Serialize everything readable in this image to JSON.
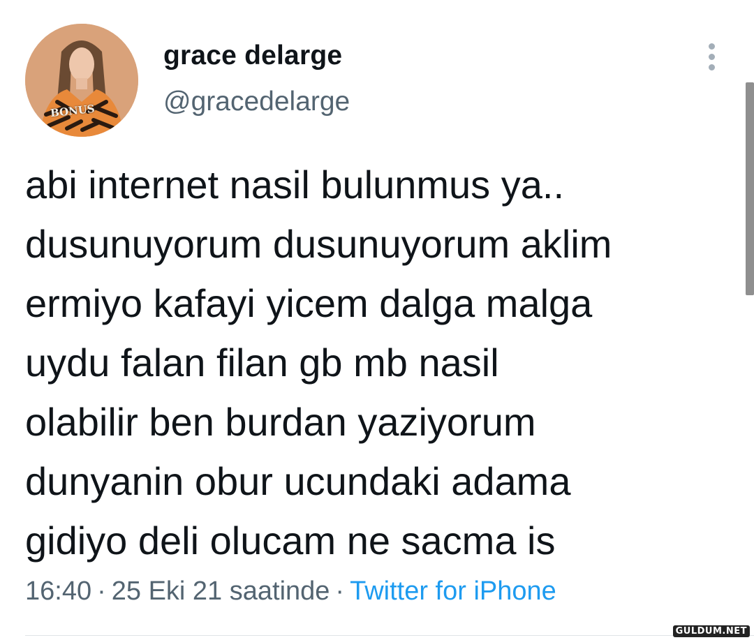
{
  "author": {
    "display_name": "grace delarge",
    "handle": "@gracedelarge",
    "avatar_badge": "BONUS"
  },
  "tweet": {
    "lines": [
      "abi internet nasil bulunmus ya..",
      "dusunuyorum dusunuyorum aklim",
      "ermiyo kafayi yicem dalga malga",
      "uydu falan filan gb mb nasil",
      "olabilir ben burdan yaziyorum",
      "dunyanin obur ucundaki adama",
      "gidiyo deli olucam ne sacma is"
    ]
  },
  "meta": {
    "time": "16:40",
    "separator": "·",
    "date": "25 Eki 21 saatinde",
    "source": "Twitter for iPhone"
  },
  "icons": {
    "more": "more-vertical-icon"
  },
  "watermark": "GULDUM.NET",
  "colors": {
    "text": "#0f1419",
    "secondary": "#536471",
    "link": "#1d9bf0"
  }
}
